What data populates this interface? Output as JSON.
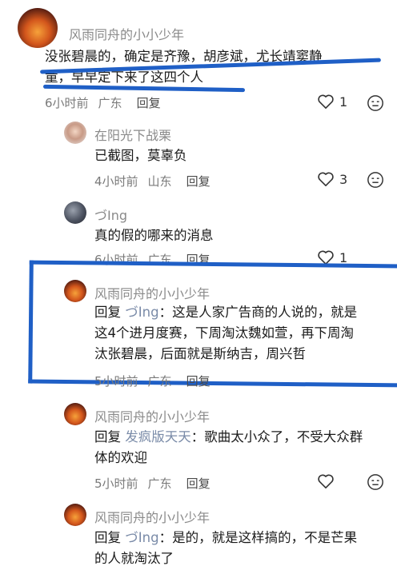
{
  "colors": {
    "highlight": "#1f5fc6",
    "reply_target": "#7a8ba8"
  },
  "comments": [
    {
      "name": "风雨同舟的小小少年",
      "line1": "没张碧晨的，确定是齐豫，胡彦斌，尤长靖窦静",
      "line2": "童，早早定下来了这四个人",
      "time": "6小时前",
      "location": "广东",
      "reply": "回复",
      "likes": "1",
      "avatar": "sunset-avatar"
    },
    {
      "name": "在阳光下战栗",
      "line1": "已截图，莫辜负",
      "time": "4小时前",
      "location": "山东",
      "reply": "回复",
      "likes": "3",
      "avatar": "person-avatar"
    },
    {
      "name": "づIng",
      "line1": "真的假的哪来的消息",
      "time": "6小时前",
      "location": "广东",
      "reply": "回复",
      "likes": "1",
      "avatar": "dark-avatar"
    },
    {
      "name": "风雨同舟的小小少年",
      "reply_prefix": "回复",
      "reply_target": "づIng",
      "line1": "：这是人家广告商的人说的，就是",
      "line2": "这4个进月度赛，下周淘汰魏如萱，再下周淘",
      "line3": "汰张碧晨，后面就是斯纳吉，周兴哲",
      "time": "5小时前",
      "location": "广东",
      "reply": "回复",
      "avatar": "sunset-avatar"
    },
    {
      "name": "风雨同舟的小小少年",
      "reply_prefix": "回复",
      "reply_target": "发疯版天天",
      "line1": "：歌曲太小众了，不受大众群",
      "line2": "体的欢迎",
      "time": "5小时前",
      "location": "广东",
      "reply": "回复",
      "avatar": "sunset-avatar"
    },
    {
      "name": "风雨同舟的小小少年",
      "reply_prefix": "回复",
      "reply_target": "づIng",
      "line1": "：是的，就是这样搞的，不是芒果",
      "line2": "的人就淘汰了",
      "avatar": "sunset-avatar"
    }
  ]
}
